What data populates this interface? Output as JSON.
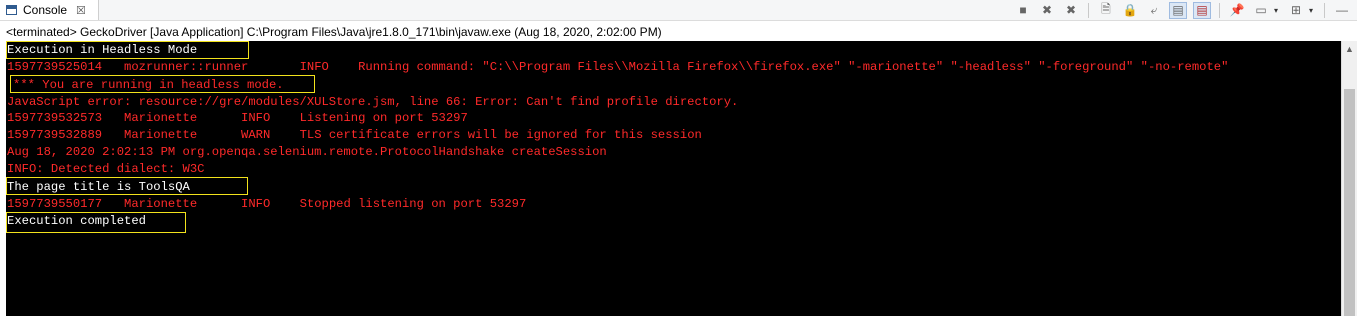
{
  "tab": {
    "label": "Console",
    "close_symbol": "☒"
  },
  "toolbar": {
    "buttons": [
      {
        "name": "terminate-icon",
        "glyph": "■"
      },
      {
        "name": "remove-launch-icon",
        "glyph": "✖"
      },
      {
        "name": "remove-all-terminated-icon",
        "glyph": "✖"
      },
      {
        "name": "clear-console-icon",
        "glyph": "🗎"
      },
      {
        "name": "scroll-lock-icon",
        "glyph": "🔒"
      },
      {
        "name": "word-wrap-icon",
        "glyph": "⤶"
      },
      {
        "name": "show-when-stdout-changes-icon",
        "glyph": "▤"
      },
      {
        "name": "show-when-stderr-changes-icon",
        "glyph": "▤"
      },
      {
        "name": "pin-console-icon",
        "glyph": "📌"
      },
      {
        "name": "display-selected-console-icon",
        "glyph": "▭"
      },
      {
        "name": "display-selected-console-dropdown-icon",
        "glyph": "▾"
      },
      {
        "name": "open-console-icon",
        "glyph": "⊞"
      },
      {
        "name": "open-console-dropdown-icon",
        "glyph": "▾"
      },
      {
        "name": "minimize-icon",
        "glyph": "—"
      }
    ]
  },
  "status_line": "<terminated> GeckoDriver [Java Application] C:\\Program Files\\Java\\jre1.8.0_171\\bin\\javaw.exe (Aug 18, 2020, 2:02:00 PM)",
  "colors": {
    "stdout": "#ffffff",
    "stderr": "#ff2a2a",
    "highlight_box": "#f2e21c",
    "console_bg": "#000000"
  },
  "console": {
    "lines": [
      {
        "text": "Execution in Headless Mode",
        "stream": "stdout"
      },
      {
        "text": "1597739525014\tmozrunner::runner\tINFO\tRunning command: \"C:\\\\Program Files\\\\Mozilla Firefox\\\\firefox.exe\" \"-marionette\" \"-headless\" \"-foreground\" \"-no-remote\"",
        "stream": "stderr"
      },
      {
        "text": "*** You are running in headless mode.",
        "stream": "stderr"
      },
      {
        "text": "JavaScript error: resource://gre/modules/XULStore.jsm, line 66: Error: Can't find profile directory.",
        "stream": "stderr"
      },
      {
        "text": "1597739532573\tMarionette\tINFO\tListening on port 53297",
        "stream": "stderr"
      },
      {
        "text": "1597739532889\tMarionette\tWARN\tTLS certificate errors will be ignored for this session",
        "stream": "stderr"
      },
      {
        "text": "Aug 18, 2020 2:02:13 PM org.openqa.selenium.remote.ProtocolHandshake createSession",
        "stream": "stderr"
      },
      {
        "text": "INFO: Detected dialect: W3C",
        "stream": "stderr"
      },
      {
        "text": "The page title is ToolsQA",
        "stream": "stdout"
      },
      {
        "text": "1597739550177\tMarionette\tINFO\tStopped listening on port 53297",
        "stream": "stderr"
      },
      {
        "text": "Execution completed",
        "stream": "stdout"
      }
    ]
  }
}
